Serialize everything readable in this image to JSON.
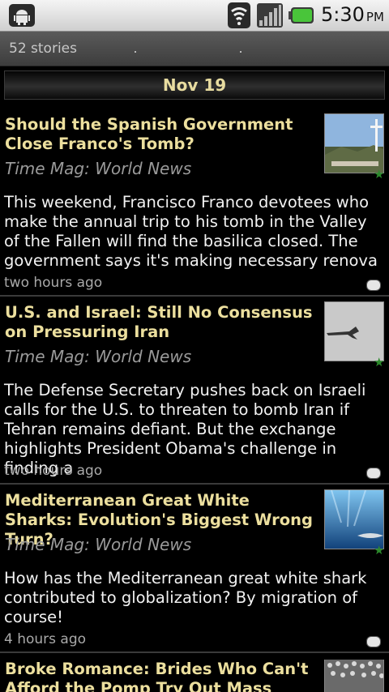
{
  "status_bar": {
    "time": "5:30",
    "ampm": "PM",
    "icons": [
      "android-notification-icon",
      "wifi-icon",
      "signal-icon",
      "battery-icon"
    ]
  },
  "header": {
    "story_count": "52 stories"
  },
  "date_header": {
    "label": "Nov 19"
  },
  "stories": [
    {
      "title": "Should the Spanish Government Close Franco's Tomb?",
      "source": "Time Mag: World News",
      "summary": "This weekend, Francisco Franco devotees who make the annual trip to his tomb in the Valley of the Fallen will find the basilica closed. The government says it's making necessary renova",
      "time": "two hours ago"
    },
    {
      "title": "U.S. and Israel: Still No Consensus on Pressuring Iran",
      "source": "Time Mag: World News",
      "summary": "The Defense Secretary pushes back on Israeli calls for the U.S. to threaten to bomb Iran if Tehran remains defiant. But the exchange highlights President Obama's challenge in finding a",
      "time": "two hours ago"
    },
    {
      "title": "Mediterranean Great White Sharks: Evolution's Biggest Wrong Turn?",
      "source": "Time Mag: World News",
      "summary": "How has the Mediterranean great white shark contributed to globalization? By migration of course!",
      "time": "4 hours ago"
    },
    {
      "title": "Broke Romance: Brides Who Can't Afford the Pomp Try Out Mass",
      "source": "",
      "summary": "",
      "time": ""
    }
  ],
  "colors": {
    "title": "#ecdf9e",
    "star": "#2c8a2c",
    "background": "#000000"
  }
}
